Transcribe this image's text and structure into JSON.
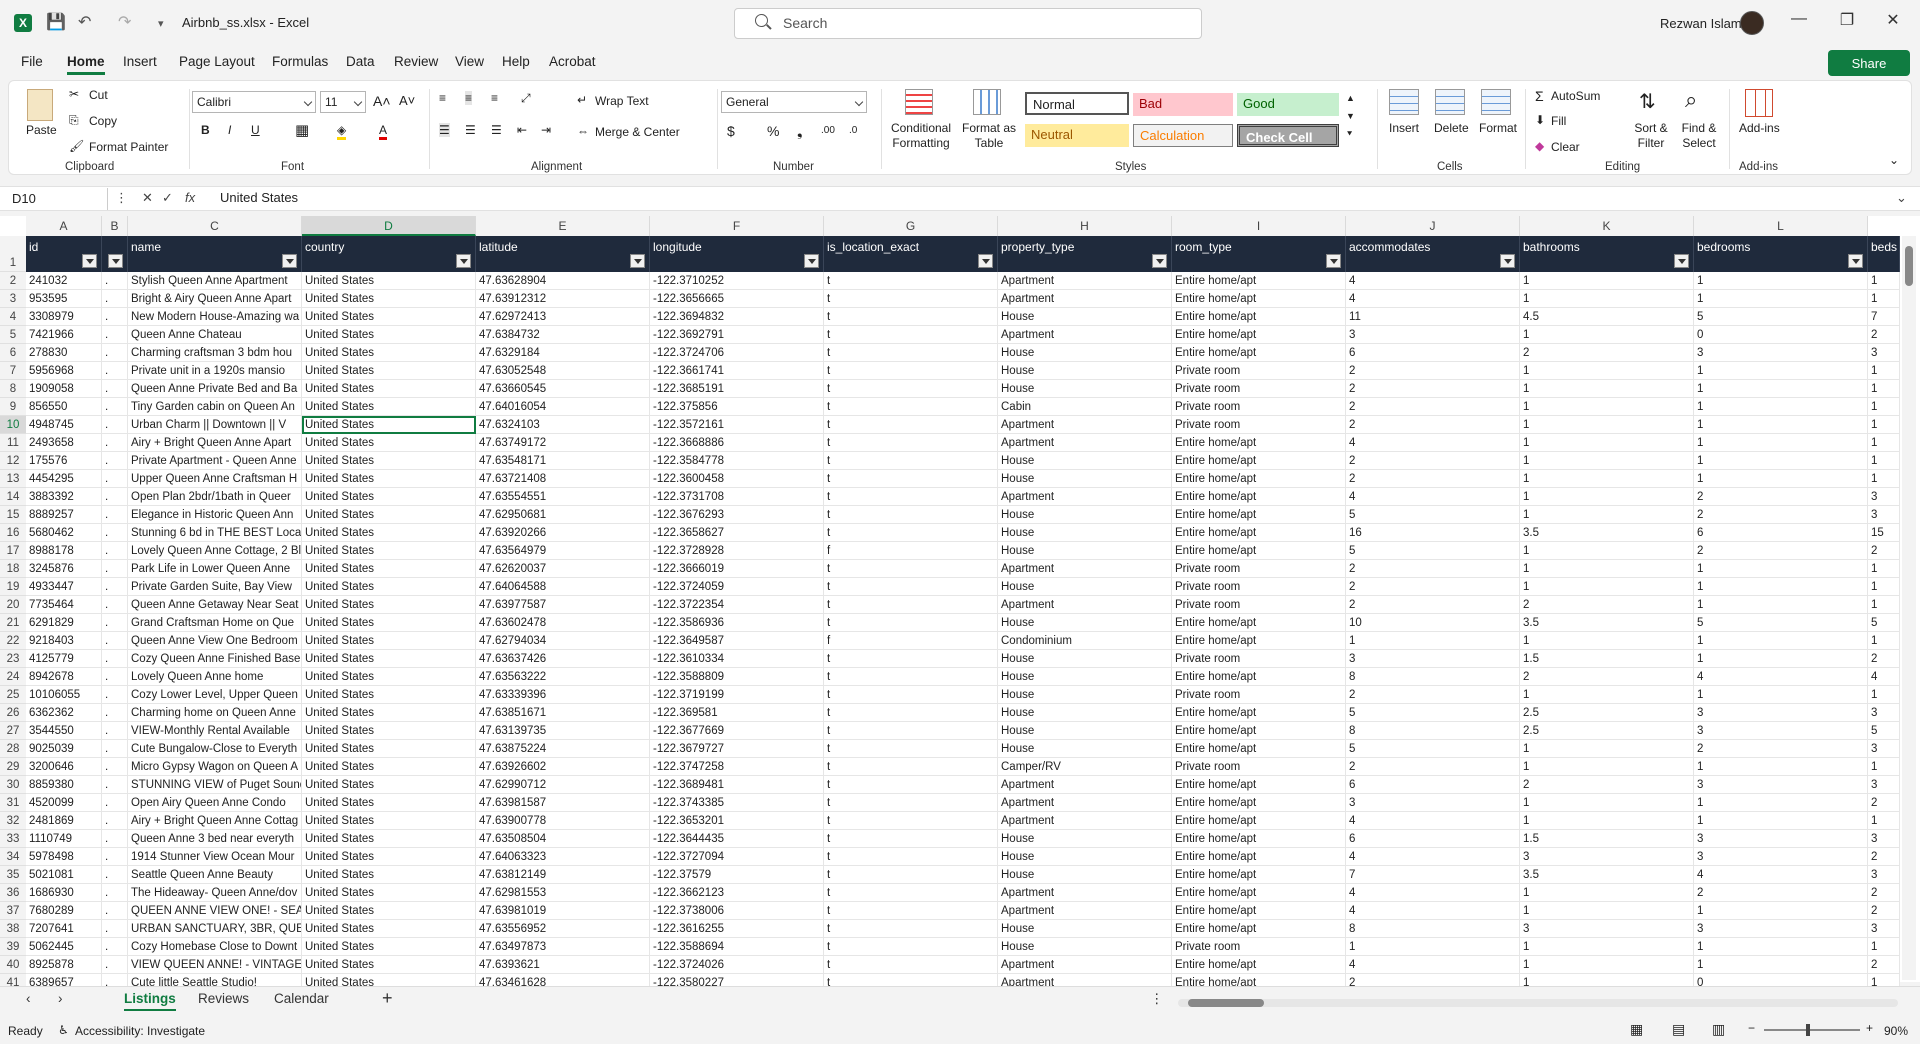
{
  "app": {
    "title": "Airbnb_ss.xlsx  -  Excel",
    "search_placeholder": "Search",
    "user": "Rezwan Islam",
    "share": "Share"
  },
  "menu": [
    "File",
    "Home",
    "Insert",
    "Page Layout",
    "Formulas",
    "Data",
    "Review",
    "View",
    "Help",
    "Acrobat"
  ],
  "ribbon": {
    "clipboard": {
      "label": "Clipboard",
      "paste": "Paste",
      "cut": "Cut",
      "copy": "Copy",
      "format_painter": "Format Painter"
    },
    "font": {
      "label": "Font",
      "name": "Calibri",
      "size": "11"
    },
    "alignment": {
      "label": "Alignment",
      "wrap": "Wrap Text",
      "merge": "Merge & Center"
    },
    "number": {
      "label": "Number",
      "format": "General"
    },
    "styles": {
      "label": "Styles",
      "cond": "Conditional Formatting",
      "fmt_table": "Format as Table",
      "normal": "Normal",
      "bad": "Bad",
      "good": "Good",
      "neutral": "Neutral",
      "calculation": "Calculation",
      "check": "Check Cell"
    },
    "cells": {
      "label": "Cells",
      "insert": "Insert",
      "delete": "Delete",
      "format": "Format"
    },
    "editing": {
      "label": "Editing",
      "autosum": "AutoSum",
      "fill": "Fill",
      "clear": "Clear",
      "sort": "Sort & Filter",
      "find": "Find & Select"
    },
    "addins": {
      "label": "Add-ins",
      "addins": "Add-ins"
    }
  },
  "formula": {
    "namebox": "D10",
    "fx": "fx",
    "value": "United States"
  },
  "columns": [
    "A",
    "B",
    "C",
    "D",
    "E",
    "F",
    "G",
    "H",
    "I",
    "J",
    "K",
    "L"
  ],
  "headers": [
    "id",
    "",
    "name",
    "country",
    "latitude",
    "longitude",
    "is_location_exact",
    "property_type",
    "room_type",
    "accommodates",
    "bathrooms",
    "bedrooms",
    "beds"
  ],
  "rows": [
    [
      "241032",
      ".",
      "Stylish Queen Anne Apartment",
      "United States",
      "47.63628904",
      "-122.3710252",
      "t",
      "Apartment",
      "Entire home/apt",
      "4",
      "1",
      "1",
      "1"
    ],
    [
      "953595",
      ".",
      "Bright & Airy Queen Anne Apart",
      "United States",
      "47.63912312",
      "-122.3656665",
      "t",
      "Apartment",
      "Entire home/apt",
      "4",
      "1",
      "1",
      "1"
    ],
    [
      "3308979",
      ".",
      "New Modern House-Amazing wa",
      "United States",
      "47.62972413",
      "-122.3694832",
      "t",
      "House",
      "Entire home/apt",
      "11",
      "4.5",
      "5",
      "7"
    ],
    [
      "7421966",
      ".",
      "Queen Anne Chateau",
      "United States",
      "47.6384732",
      "-122.3692791",
      "t",
      "Apartment",
      "Entire home/apt",
      "3",
      "1",
      "0",
      "2"
    ],
    [
      "278830",
      ".",
      "Charming craftsman 3 bdm hou",
      "United States",
      "47.6329184",
      "-122.3724706",
      "t",
      "House",
      "Entire home/apt",
      "6",
      "2",
      "3",
      "3"
    ],
    [
      "5956968",
      ".",
      "Private unit in a 1920s mansio",
      "United States",
      "47.63052548",
      "-122.3661741",
      "t",
      "House",
      "Private room",
      "2",
      "1",
      "1",
      "1"
    ],
    [
      "1909058",
      ".",
      "Queen Anne Private Bed and Ba",
      "United States",
      "47.63660545",
      "-122.3685191",
      "t",
      "House",
      "Private room",
      "2",
      "1",
      "1",
      "1"
    ],
    [
      "856550",
      ".",
      "Tiny Garden cabin on Queen An",
      "United States",
      "47.64016054",
      "-122.375856",
      "t",
      "Cabin",
      "Private room",
      "2",
      "1",
      "1",
      "1"
    ],
    [
      "4948745",
      ".",
      "Urban Charm || Downtown || V",
      "United States",
      "47.6324103",
      "-122.3572161",
      "t",
      "Apartment",
      "Private room",
      "2",
      "1",
      "1",
      "1"
    ],
    [
      "2493658",
      ".",
      "Airy + Bright Queen Anne Apart",
      "United States",
      "47.63749172",
      "-122.3668886",
      "t",
      "Apartment",
      "Entire home/apt",
      "4",
      "1",
      "1",
      "1"
    ],
    [
      "175576",
      ".",
      "Private Apartment - Queen Anne",
      "United States",
      "47.63548171",
      "-122.3584778",
      "t",
      "House",
      "Entire home/apt",
      "2",
      "1",
      "1",
      "1"
    ],
    [
      "4454295",
      ".",
      "Upper Queen Anne Craftsman H",
      "United States",
      "47.63721408",
      "-122.3600458",
      "t",
      "House",
      "Entire home/apt",
      "2",
      "1",
      "1",
      "1"
    ],
    [
      "3883392",
      ".",
      "Open Plan 2bdr/1bath in Queer",
      "United States",
      "47.63554551",
      "-122.3731708",
      "t",
      "Apartment",
      "Entire home/apt",
      "4",
      "1",
      "2",
      "3"
    ],
    [
      "8889257",
      ".",
      "Elegance in Historic Queen Ann",
      "United States",
      "47.62950681",
      "-122.3676293",
      "t",
      "House",
      "Entire home/apt",
      "5",
      "1",
      "2",
      "3"
    ],
    [
      "5680462",
      ".",
      "Stunning 6 bd in THE BEST Locat",
      "United States",
      "47.63920266",
      "-122.3658627",
      "t",
      "House",
      "Entire home/apt",
      "16",
      "3.5",
      "6",
      "15"
    ],
    [
      "8988178",
      ".",
      "Lovely Queen Anne Cottage, 2 Bl",
      "United States",
      "47.63564979",
      "-122.3728928",
      "f",
      "House",
      "Entire home/apt",
      "5",
      "1",
      "2",
      "2"
    ],
    [
      "3245876",
      ".",
      "Park Life in Lower Queen Anne",
      "United States",
      "47.62620037",
      "-122.3666019",
      "t",
      "Apartment",
      "Private room",
      "2",
      "1",
      "1",
      "1"
    ],
    [
      "4933447",
      ".",
      "Private Garden Suite, Bay View",
      "United States",
      "47.64064588",
      "-122.3724059",
      "t",
      "House",
      "Private room",
      "2",
      "1",
      "1",
      "1"
    ],
    [
      "7735464",
      ".",
      "Queen Anne Getaway Near Seat",
      "United States",
      "47.63977587",
      "-122.3722354",
      "t",
      "Apartment",
      "Private room",
      "2",
      "2",
      "1",
      "1"
    ],
    [
      "6291829",
      ".",
      "Grand Craftsman Home on Que",
      "United States",
      "47.63602478",
      "-122.3586936",
      "t",
      "House",
      "Entire home/apt",
      "10",
      "3.5",
      "5",
      "5"
    ],
    [
      "9218403",
      ".",
      "Queen Anne View One Bedroom",
      "United States",
      "47.62794034",
      "-122.3649587",
      "f",
      "Condominium",
      "Entire home/apt",
      "1",
      "1",
      "1",
      "1"
    ],
    [
      "4125779",
      ".",
      "Cozy Queen Anne Finished Base",
      "United States",
      "47.63637426",
      "-122.3610334",
      "t",
      "House",
      "Private room",
      "3",
      "1.5",
      "1",
      "2"
    ],
    [
      "8942678",
      ".",
      "Lovely Queen Anne home",
      "United States",
      "47.63563222",
      "-122.3588809",
      "t",
      "House",
      "Entire home/apt",
      "8",
      "2",
      "4",
      "4"
    ],
    [
      "10106055",
      ".",
      "Cozy Lower Level, Upper Queen",
      "United States",
      "47.63339396",
      "-122.3719199",
      "t",
      "House",
      "Private room",
      "2",
      "1",
      "1",
      "1"
    ],
    [
      "6362362",
      ".",
      "Charming home on Queen Anne",
      "United States",
      "47.63851671",
      "-122.369581",
      "t",
      "House",
      "Entire home/apt",
      "5",
      "2.5",
      "3",
      "3"
    ],
    [
      "3544550",
      ".",
      "VIEW-Monthly Rental Available",
      "United States",
      "47.63139735",
      "-122.3677669",
      "t",
      "House",
      "Entire home/apt",
      "8",
      "2.5",
      "3",
      "5"
    ],
    [
      "9025039",
      ".",
      "Cute Bungalow-Close to Everyth",
      "United States",
      "47.63875224",
      "-122.3679727",
      "t",
      "House",
      "Entire home/apt",
      "5",
      "1",
      "2",
      "3"
    ],
    [
      "3200646",
      ".",
      "Micro Gypsy Wagon on Queen A",
      "United States",
      "47.63926602",
      "-122.3747258",
      "t",
      "Camper/RV",
      "Private room",
      "2",
      "1",
      "1",
      "1"
    ],
    [
      "8859380",
      ".",
      "STUNNING VIEW of Puget Sound",
      "United States",
      "47.62990712",
      "-122.3689481",
      "t",
      "Apartment",
      "Entire home/apt",
      "6",
      "2",
      "3",
      "3"
    ],
    [
      "4520099",
      ".",
      "Open Airy Queen Anne Condo",
      "United States",
      "47.63981587",
      "-122.3743385",
      "t",
      "Apartment",
      "Entire home/apt",
      "3",
      "1",
      "1",
      "2"
    ],
    [
      "2481869",
      ".",
      "Airy + Bright Queen Anne Cottag",
      "United States",
      "47.63900778",
      "-122.3653201",
      "t",
      "Apartment",
      "Entire home/apt",
      "4",
      "1",
      "1",
      "1"
    ],
    [
      "1110749",
      ".",
      "Queen Anne 3 bed near everyth",
      "United States",
      "47.63508504",
      "-122.3644435",
      "t",
      "House",
      "Entire home/apt",
      "6",
      "1.5",
      "3",
      "3"
    ],
    [
      "5978498",
      ".",
      "1914 Stunner View Ocean Mour",
      "United States",
      "47.64063323",
      "-122.3727094",
      "t",
      "House",
      "Entire home/apt",
      "4",
      "3",
      "3",
      "2"
    ],
    [
      "5021081",
      ".",
      "Seattle Queen Anne Beauty",
      "United States",
      "47.63812149",
      "-122.37579",
      "t",
      "House",
      "Entire home/apt",
      "7",
      "3.5",
      "4",
      "3"
    ],
    [
      "1686930",
      ".",
      "The Hideaway- Queen Anne/dov",
      "United States",
      "47.62981553",
      "-122.3662123",
      "t",
      "Apartment",
      "Entire home/apt",
      "4",
      "1",
      "2",
      "2"
    ],
    [
      "7680289",
      ".",
      "QUEEN ANNE VIEW ONE! - SEATT",
      "United States",
      "47.63981019",
      "-122.3738006",
      "t",
      "Apartment",
      "Entire home/apt",
      "4",
      "1",
      "1",
      "2"
    ],
    [
      "7207641",
      ".",
      "URBAN SANCTUARY, 3BR, QUEEN",
      "United States",
      "47.63556952",
      "-122.3616255",
      "t",
      "House",
      "Entire home/apt",
      "8",
      "3",
      "3",
      "3"
    ],
    [
      "5062445",
      ".",
      "Cozy Homebase Close to Downt",
      "United States",
      "47.63497873",
      "-122.3588694",
      "t",
      "House",
      "Private room",
      "1",
      "1",
      "1",
      "1"
    ],
    [
      "8925878",
      ".",
      "VIEW QUEEN ANNE! - VINTAGE S",
      "United States",
      "47.6393621",
      "-122.3724026",
      "t",
      "Apartment",
      "Entire home/apt",
      "4",
      "1",
      "1",
      "2"
    ],
    [
      "6389657",
      ".",
      "Cute little Seattle Studio!",
      "United States",
      "47.63461628",
      "-122.3580227",
      "t",
      "Apartment",
      "Entire home/apt",
      "2",
      "1",
      "0",
      "1"
    ]
  ],
  "sheets": [
    "Listings",
    "Reviews",
    "Calendar"
  ],
  "status": {
    "ready": "Ready",
    "accessibility": "Accessibility: Investigate",
    "zoom": "90%"
  }
}
